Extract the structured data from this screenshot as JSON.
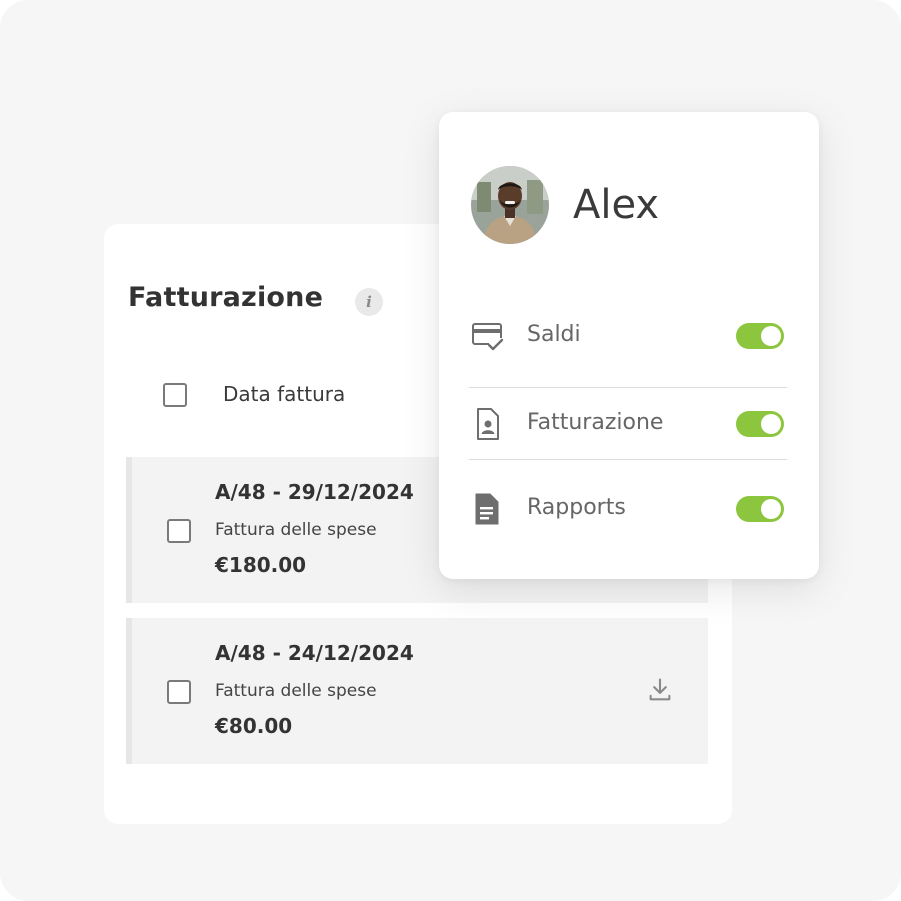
{
  "billing": {
    "title": "Fatturazione",
    "info_icon": "info-icon",
    "header": {
      "column_label": "Data fattura"
    },
    "invoices": [
      {
        "number_date": "A/48 - 29/12/2024",
        "description": "Fattura delle spese",
        "amount": "€180.00"
      },
      {
        "number_date": "A/48 - 24/12/2024",
        "description": "Fattura delle spese",
        "amount": "€80.00",
        "action_icon": "download-icon"
      }
    ]
  },
  "profile": {
    "name": "Alex",
    "avatar": "user-avatar",
    "permissions": [
      {
        "label": "Saldi",
        "icon": "card-check-icon",
        "enabled": true
      },
      {
        "label": "Fatturazione",
        "icon": "document-user-icon",
        "enabled": true
      },
      {
        "label": "Rapports",
        "icon": "document-icon",
        "enabled": true
      }
    ]
  },
  "colors": {
    "toggle_on": "#8cc63f",
    "background": "#f6f6f6",
    "row_background": "#f3f3f3"
  }
}
